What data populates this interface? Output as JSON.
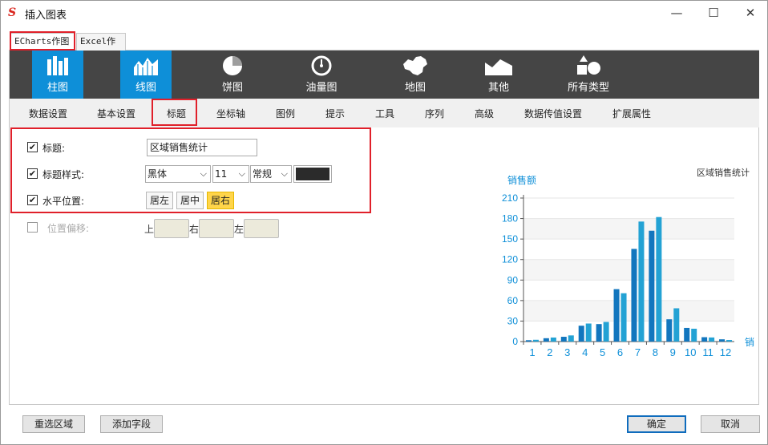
{
  "window": {
    "title": "插入图表",
    "app_icon": "s-logo-icon",
    "min": "—",
    "max": "☐",
    "close": "✕"
  },
  "outer_tabs": [
    "ECharts作图",
    "Excel作图"
  ],
  "chart_types": [
    {
      "label": "柱图",
      "icon": "bar-chart-icon"
    },
    {
      "label": "线图",
      "icon": "area-chart-icon"
    },
    {
      "label": "饼图",
      "icon": "pie-chart-icon"
    },
    {
      "label": "油量图",
      "icon": "gauge-icon"
    },
    {
      "label": "地图",
      "icon": "china-map-icon"
    },
    {
      "label": "其他",
      "icon": "mountain-icon"
    },
    {
      "label": "所有类型",
      "icon": "shapes-icon"
    }
  ],
  "sub_tabs": [
    "数据设置",
    "基本设置",
    "标题",
    "坐标轴",
    "图例",
    "提示",
    "工具",
    "序列",
    "高级",
    "数据传值设置",
    "扩展属性"
  ],
  "title_settings": {
    "title_label": "标题:",
    "title_value": "区域销售统计",
    "style_label": "标题样式:",
    "font": "黑体",
    "size": "11",
    "weight": "常规",
    "color": "#2b2b2b",
    "hpos_label": "水平位置:",
    "hpos_options": [
      "居左",
      "居中",
      "居右"
    ],
    "hpos_selected": "居右",
    "offset_label": "位置偏移:",
    "offset_top": "上",
    "offset_right": "右",
    "offset_left": "左"
  },
  "chart_data": {
    "type": "bar",
    "title": "区域销售统计",
    "ylabel": "销售额",
    "xlabel": "销",
    "ylim": [
      0,
      210
    ],
    "yticks": [
      0,
      30,
      60,
      90,
      120,
      150,
      180,
      210
    ],
    "categories": [
      "1",
      "2",
      "3",
      "4",
      "5",
      "6",
      "7",
      "8",
      "9",
      "10",
      "11",
      "12"
    ],
    "series": [
      {
        "values": [
          2.6,
          5.9,
          9.0,
          26.4,
          28.7,
          70.7,
          175.6,
          182.2,
          48.7,
          18.8,
          6.0,
          2.3
        ],
        "color": "#23a2d4"
      },
      {
        "values": [
          2.0,
          4.9,
          7.0,
          23.2,
          25.6,
          76.7,
          135.6,
          162.2,
          32.6,
          20.0,
          6.4,
          3.3
        ],
        "color": "#1276be"
      }
    ],
    "legend": "none",
    "grid": true,
    "accent": "#0e8fd8"
  },
  "buttons": {
    "reselect": "重选区域",
    "add_field": "添加字段",
    "ok": "确定",
    "cancel": "取消"
  }
}
